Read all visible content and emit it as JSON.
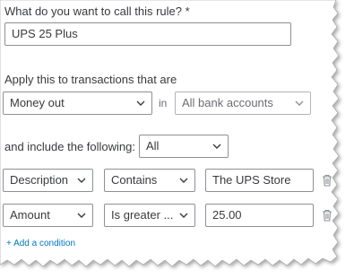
{
  "rule_name": {
    "label": "What do you want to call this rule? *",
    "value": "UPS 25 Plus"
  },
  "apply_to": {
    "label": "Apply this to transactions that are",
    "direction": {
      "value": "Money out",
      "icon": "chevron-down-icon"
    },
    "connector": "in",
    "accounts": {
      "value": "All bank accounts",
      "icon": "chevron-down-icon"
    }
  },
  "include": {
    "label": "and include the following:",
    "match": {
      "value": "All",
      "icon": "chevron-down-icon"
    }
  },
  "conditions": [
    {
      "field": "Description",
      "operator": "Contains",
      "value": "The UPS Store",
      "delete_icon": "trash-icon"
    },
    {
      "field": "Amount",
      "operator": "Is greater ...",
      "value": "25.00",
      "delete_icon": "trash-icon"
    }
  ],
  "add_condition_label": "+ Add a condition",
  "colors": {
    "text": "#393a3d",
    "border": "#8d9096",
    "link": "#0077c5"
  }
}
